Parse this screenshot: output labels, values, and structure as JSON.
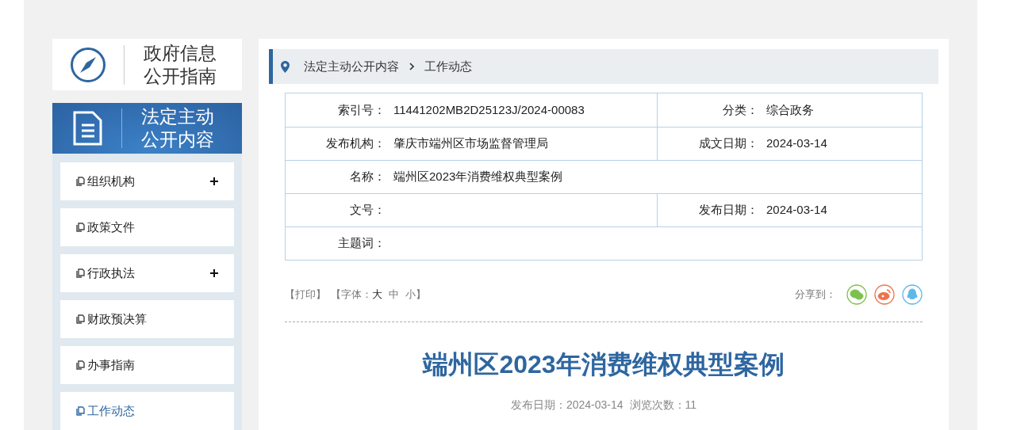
{
  "guide_panel": {
    "title_lines": [
      "政府信息",
      "公开指南"
    ]
  },
  "section_panel": {
    "title_lines": [
      "法定主动",
      "公开内容"
    ]
  },
  "sidebar": {
    "items": [
      {
        "label": "组织机构",
        "expandable": true,
        "selected": false
      },
      {
        "label": "政策文件",
        "expandable": false,
        "selected": false
      },
      {
        "label": "行政执法",
        "expandable": true,
        "selected": false
      },
      {
        "label": "财政预决算",
        "expandable": false,
        "selected": false
      },
      {
        "label": "办事指南",
        "expandable": false,
        "selected": false
      },
      {
        "label": "工作动态",
        "expandable": false,
        "selected": true
      }
    ]
  },
  "breadcrumb": [
    "法定主动公开内容",
    "工作动态"
  ],
  "info_table": {
    "rows": [
      {
        "cells": [
          {
            "label": "索引号：",
            "value": "11441202MB2D25123J/2024-00083"
          },
          {
            "label": "分类：",
            "value": "综合政务"
          }
        ]
      },
      {
        "cells": [
          {
            "label": "发布机构：",
            "value": "肇庆市端州区市场监督管理局"
          },
          {
            "label": "成文日期：",
            "value": "2024-03-14"
          }
        ]
      },
      {
        "cells": [
          {
            "label": "名称：",
            "value": "端州区2023年消费维权典型案例"
          }
        ]
      },
      {
        "cells": [
          {
            "label": "文号："
          },
          {
            "label": "发布日期：",
            "value": "2024-03-14"
          }
        ]
      },
      {
        "cells": [
          {
            "label": "主题词："
          }
        ]
      }
    ]
  },
  "toolbar": {
    "print": "【打印】",
    "font_label": "【字体：",
    "font_sizes": [
      {
        "label": "大",
        "selected": true
      },
      {
        "label": "中",
        "selected": false
      },
      {
        "label": "小",
        "selected": false
      }
    ],
    "font_close": "】",
    "share_label": "分享到：",
    "share": [
      {
        "kind": "wechat",
        "color": "#7cc24a"
      },
      {
        "kind": "weibo",
        "color": "#f0724a"
      },
      {
        "kind": "qq",
        "color": "#5db8ea"
      }
    ]
  },
  "article": {
    "title": "端州区2023年消费维权典型案例",
    "date": "发布日期：2024-03-14",
    "views": "浏览次数：11"
  }
}
